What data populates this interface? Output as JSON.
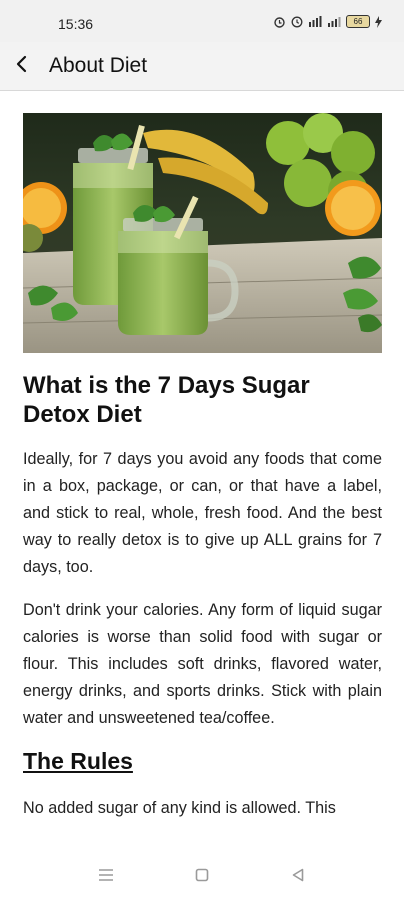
{
  "status_bar": {
    "time": "15:36",
    "battery": "66"
  },
  "app_bar": {
    "title": "About Diet",
    "back_icon": "back-arrow-icon"
  },
  "hero_image": {
    "subject": "green smoothie jars with mint, bananas, oranges and apples on wooden table"
  },
  "article": {
    "title": "What is the 7 Days Sugar Detox Diet",
    "paragraphs": [
      "Ideally, for 7 days you avoid any foods that come in a box, package, or can, or that have a label, and stick to real, whole, fresh food. And the best way to really detox is to give up ALL grains for 7 days, too.",
      "Don't drink your calories. Any form of liquid sugar calories is worse than solid food with sugar or flour. This includes soft drinks, flavored water, energy drinks, and sports drinks. Stick with plain water and unsweetened tea/coffee."
    ],
    "section_heading": "The Rules",
    "rules_intro": "No added sugar of any kind is allowed. This"
  },
  "nav_bar": {
    "icons": [
      "menu-icon",
      "home-square-icon",
      "back-triangle-icon"
    ]
  },
  "colors": {
    "status_bg": "#f1f1f1",
    "appbar_bg": "#f3f3f3",
    "text": "#111111"
  }
}
